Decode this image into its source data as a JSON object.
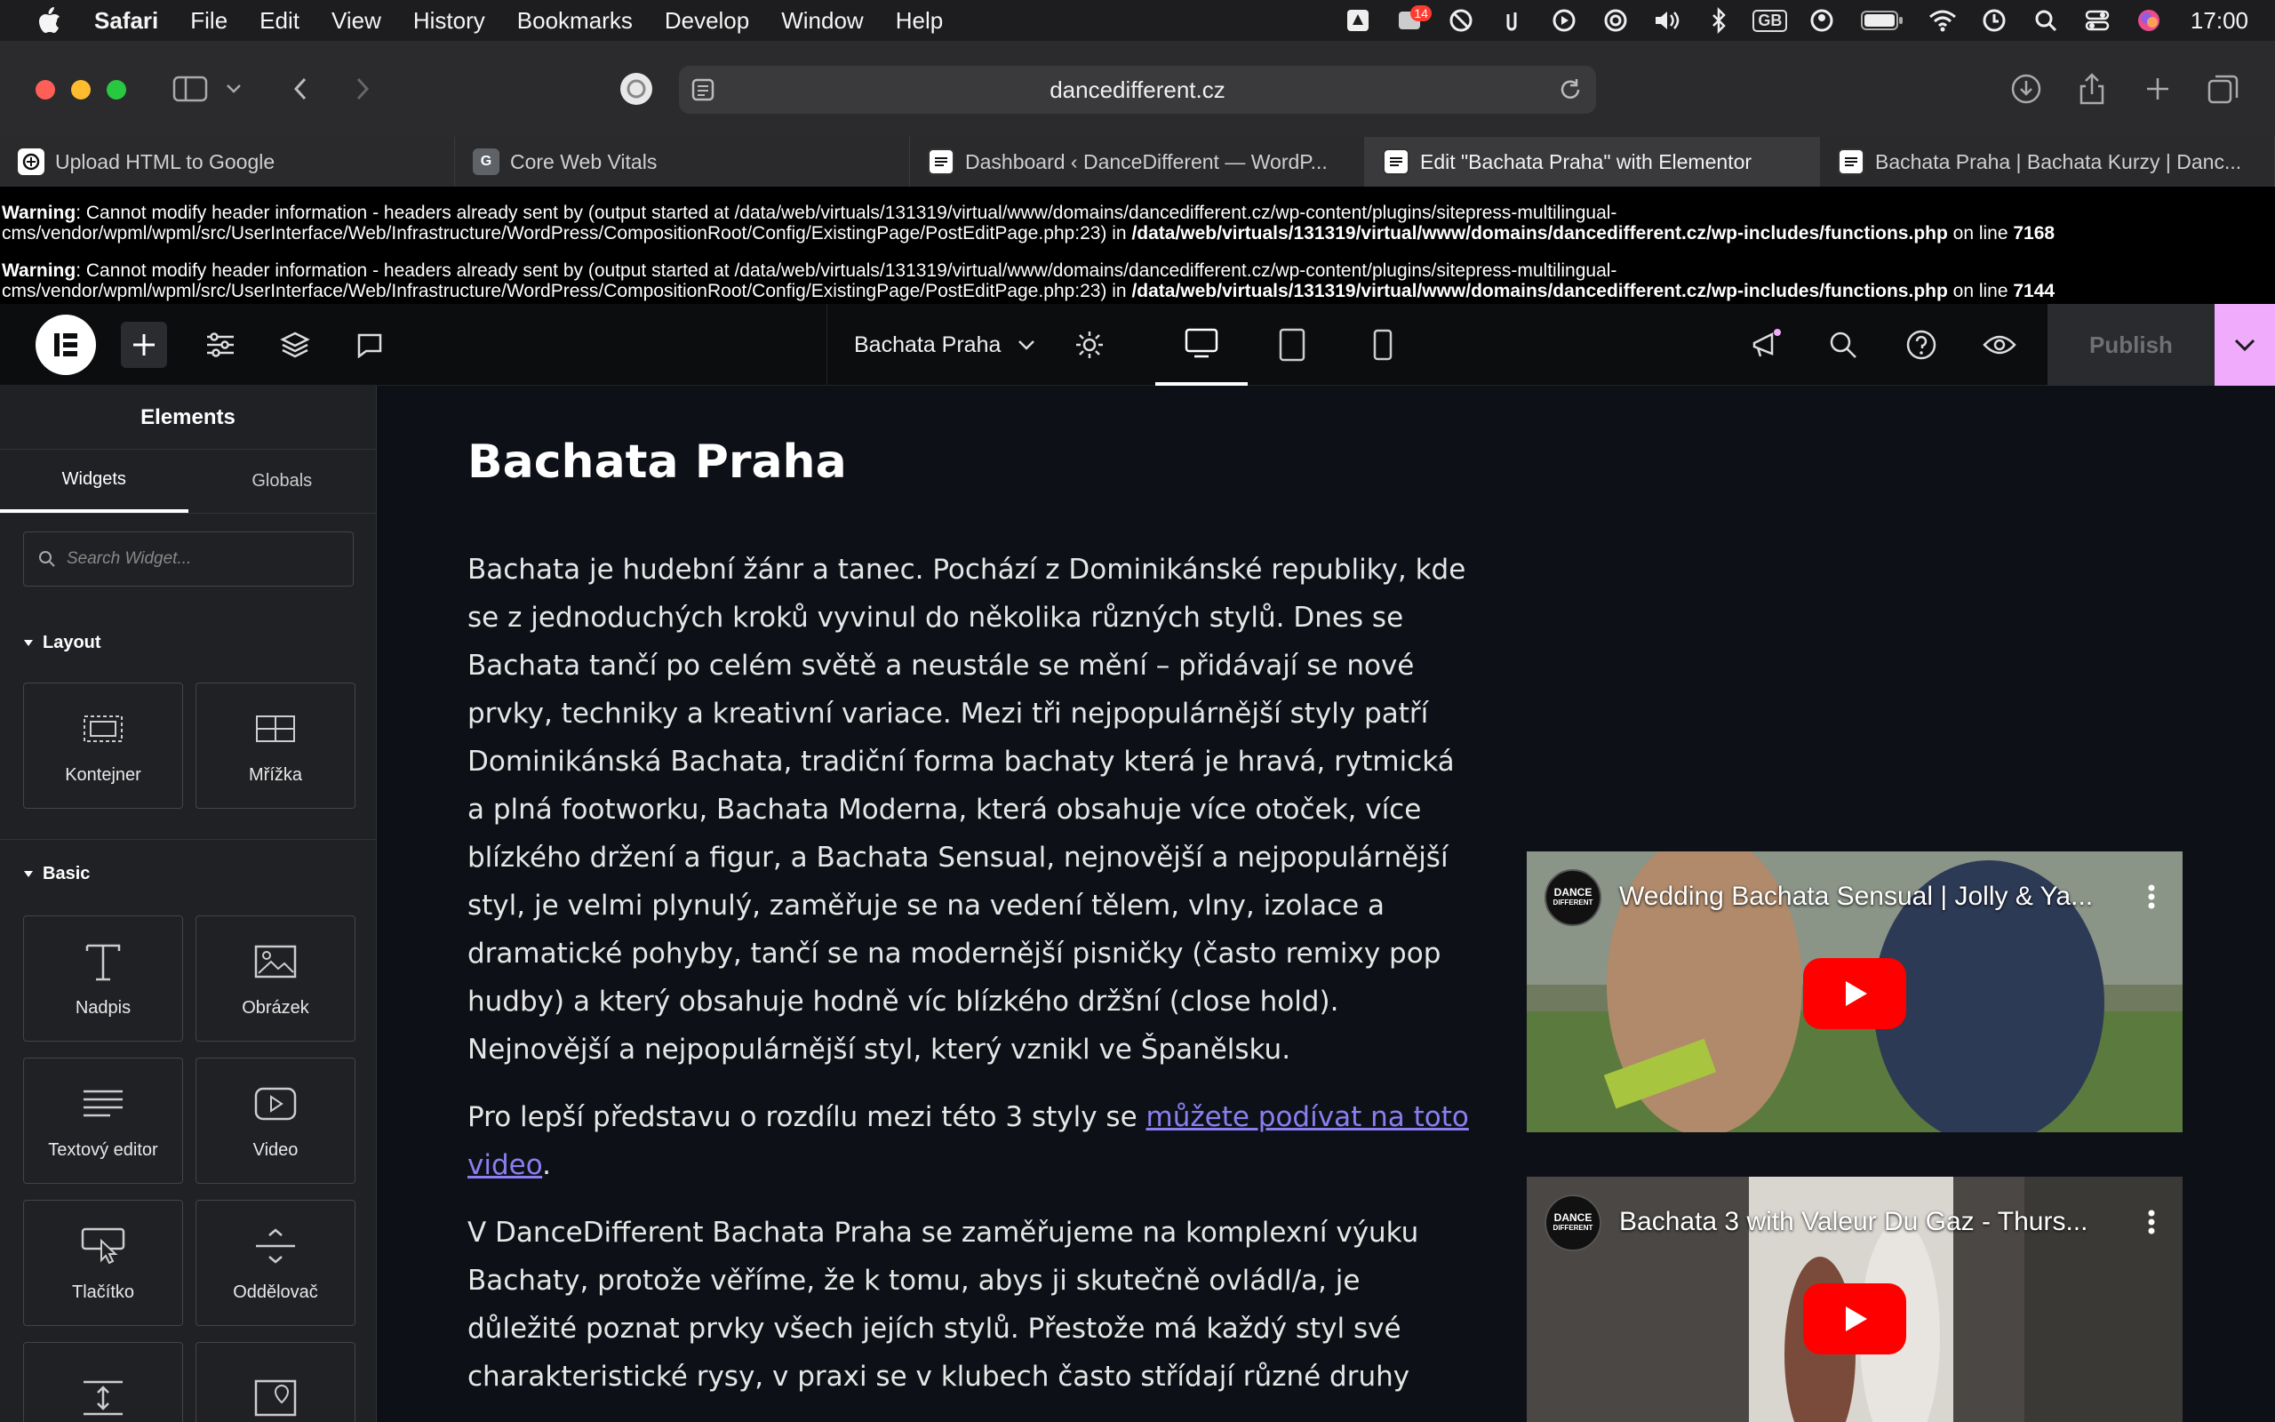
{
  "menubar": {
    "app": "Safari",
    "items": [
      "File",
      "Edit",
      "View",
      "History",
      "Bookmarks",
      "Develop",
      "Window",
      "Help"
    ],
    "badge_count": "14",
    "keyboard": "GB",
    "clock": "17:00"
  },
  "browser": {
    "url": "dancedifferent.cz",
    "tabs": [
      {
        "title": "Upload HTML to Google",
        "icon": "chatgpt-icon"
      },
      {
        "title": "Core Web Vitals",
        "icon": "g-icon",
        "letter": "G"
      },
      {
        "title": "Dashboard ‹ DanceDifferent — WordP...",
        "icon": "dance-icon"
      },
      {
        "title": "Edit \"Bachata Praha\" with Elementor",
        "icon": "dance-icon",
        "active": true
      },
      {
        "title": "Bachata Praha | Bachata Kurzy | Danc...",
        "icon": "dance-icon"
      }
    ]
  },
  "warnings": [
    {
      "label": "Warning",
      "line1": ": Cannot modify header information - headers already sent by (output started at /data/web/virtuals/131319/virtual/www/domains/dancedifferent.cz/wp-content/plugins/sitepress-multilingual-",
      "line2a": "cms/vendor/wpml/wpml/src/UserInterface/Web/Infrastructure/WordPress/CompositionRoot/Config/ExistingPage/PostEditPage.php:23) in ",
      "path": "/data/web/virtuals/131319/virtual/www/domains/dancedifferent.cz/wp-includes/functions.php",
      "on_line": " on line ",
      "line_no": "7168"
    },
    {
      "label": "Warning",
      "line1": ": Cannot modify header information - headers already sent by (output started at /data/web/virtuals/131319/virtual/www/domains/dancedifferent.cz/wp-content/plugins/sitepress-multilingual-",
      "line2a": "cms/vendor/wpml/wpml/src/UserInterface/Web/Infrastructure/WordPress/CompositionRoot/Config/ExistingPage/PostEditPage.php:23) in ",
      "path": "/data/web/virtuals/131319/virtual/www/domains/dancedifferent.cz/wp-includes/functions.php",
      "on_line": " on line ",
      "line_no": "7144"
    }
  ],
  "editor": {
    "page_name": "Bachata Praha",
    "publish_label": "Publish",
    "accent": "#f0abfc"
  },
  "panel": {
    "title": "Elements",
    "tabs": [
      "Widgets",
      "Globals"
    ],
    "search_placeholder": "Search Widget...",
    "layout_heading": "Layout",
    "basic_heading": "Basic",
    "layout_widgets": [
      "Kontejner",
      "Mřížka"
    ],
    "basic_widgets": [
      "Nadpis",
      "Obrázek",
      "Textový editor",
      "Video",
      "Tlačítko",
      "Oddělovač"
    ]
  },
  "content": {
    "heading": "Bachata Praha",
    "para1": "Bachata je hudební žánr a tanec. Pochází z Dominikánské republiky, kde se z jednoduchých kroků vyvinul do několika různých stylů. Dnes se Bachata tančí po celém světě a neustále se mění – přidávají se nové prvky, techniky a kreativní variace. Mezi tři nejpopulárnější styly patří Dominikánská Bachata, tradiční forma bachaty která je hravá, rytmická a plná footworku, Bachata Moderna, která obsahuje více otoček, více blízkého držení a figur, a Bachata Sensual, nejnovější a nejpopulárnější styl, je velmi plynulý, zaměřuje se na vedení tělem, vlny, izolace a dramatické pohyby, tančí se na modernější pisničky (často remixy pop hudby) a který obsahuje hodně víc blízkého držšní (close hold). Nejnovější a nejpopulárnější styl, který vznikl ve Španělsku.",
    "para2_before": "Pro lepší představu o rozdílu mezi této 3 styly se ",
    "para2_link": "můžete podívat na toto video",
    "para2_after": ".",
    "para3": "V DanceDifferent Bachata Praha se zaměřujeme na komplexní výuku Bachaty, protože věříme, že k tomu, abys ji skutečně ovládl/a, je důležité poznat prvky všech jejích stylů. Přestože má každý styl své charakteristické rysy, v praxi se v klubech často střídají různé druhy"
  },
  "videos": [
    {
      "title": "Wedding Bachata Sensual | Jolly & Ya...",
      "channel_line1": "DANCE",
      "channel_line2": "DIFFERENT"
    },
    {
      "title": "Bachata 3 with Valeur Du Gaz - Thurs...",
      "channel_line1": "DANCE",
      "channel_line2": "DIFFERENT"
    }
  ]
}
